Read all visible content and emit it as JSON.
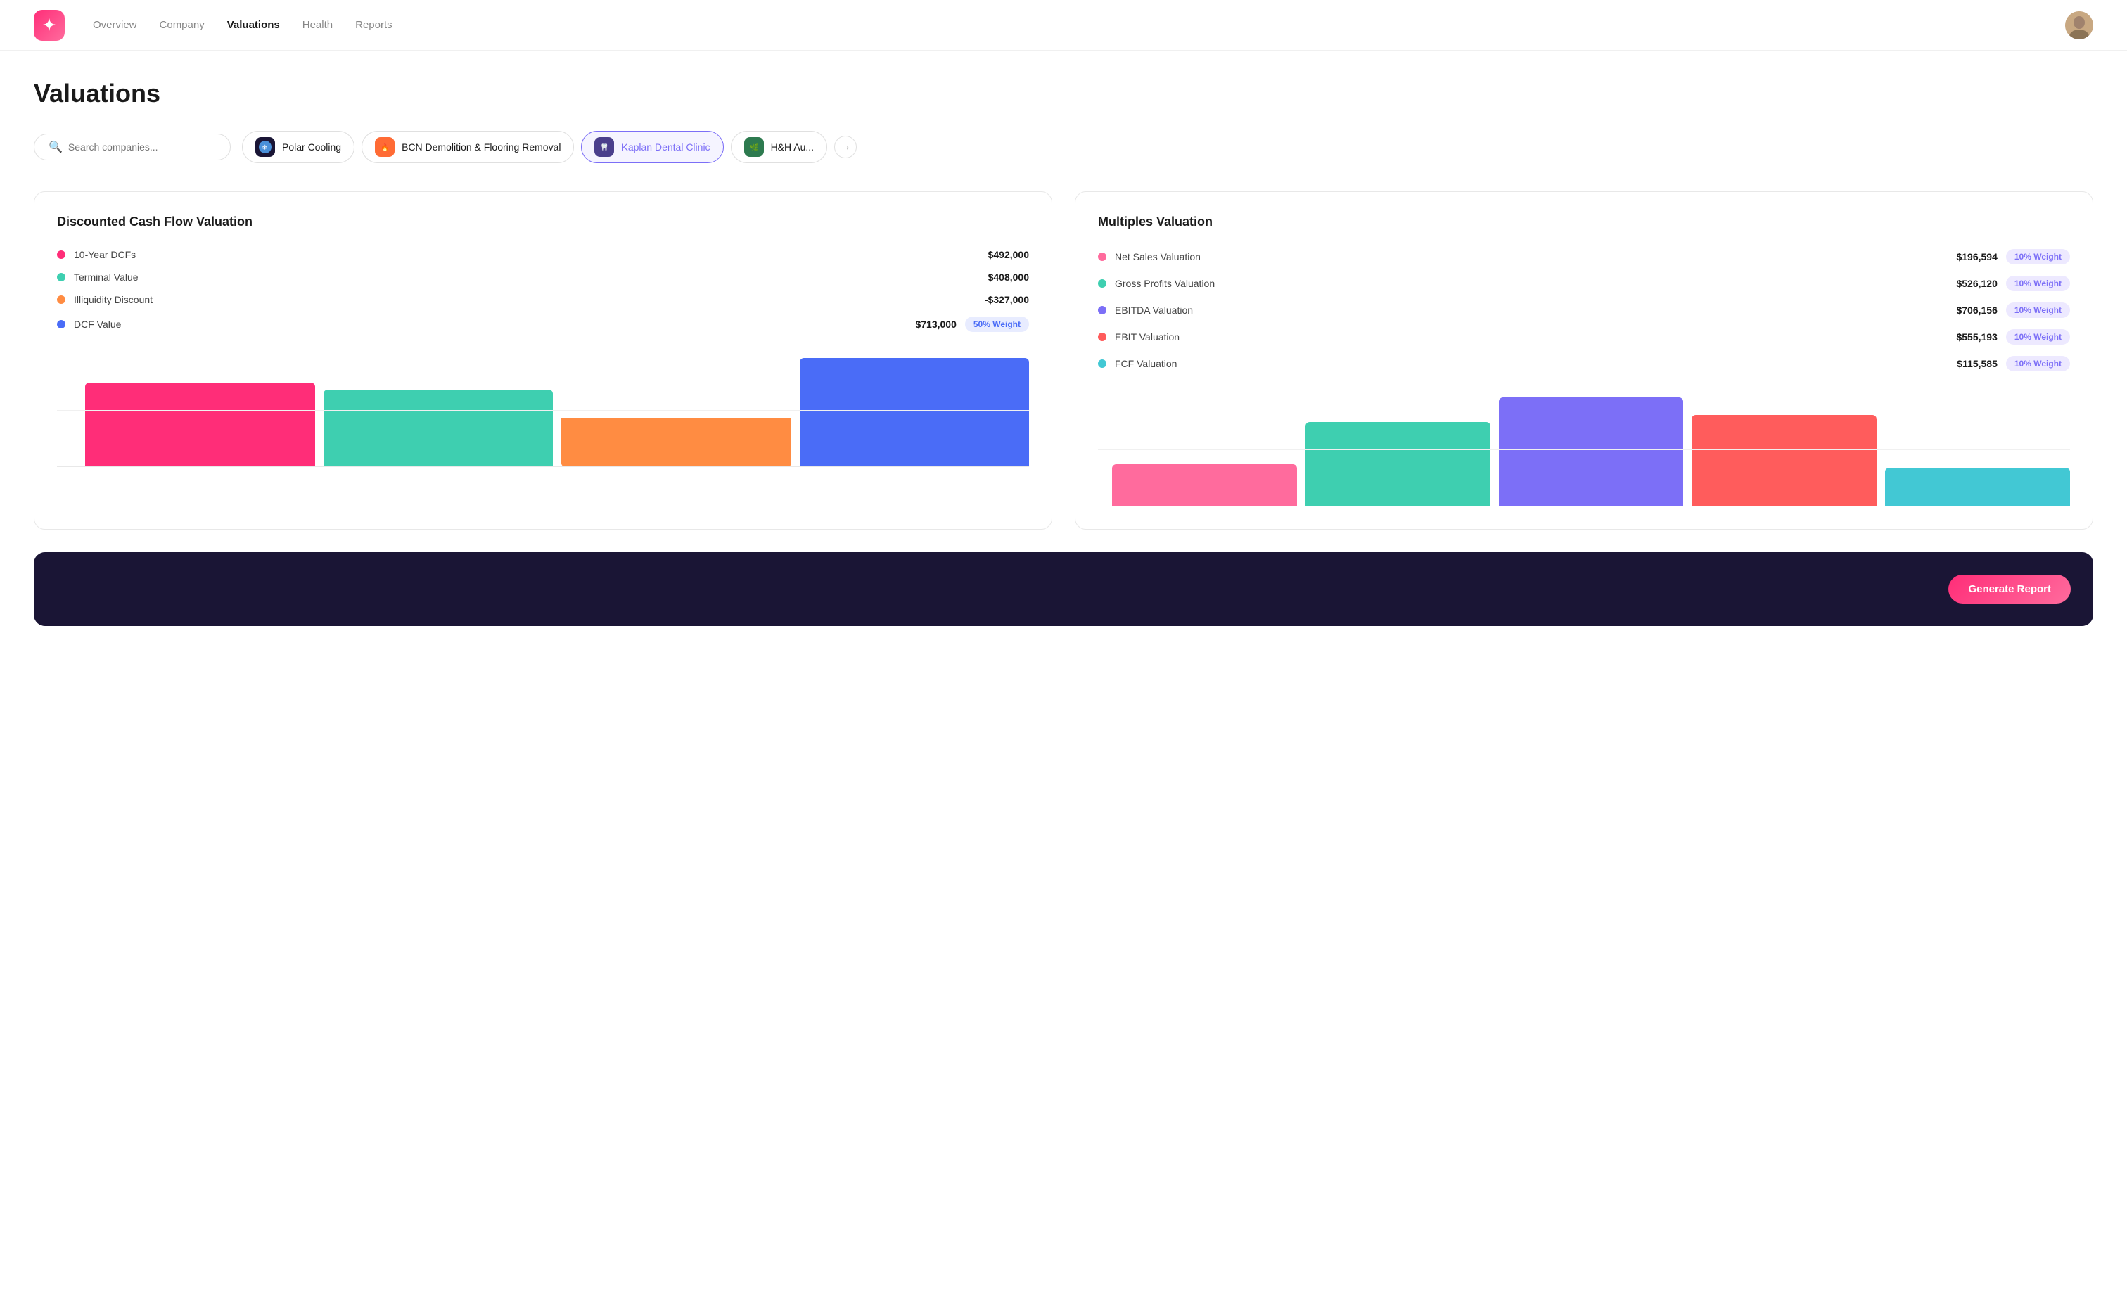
{
  "nav": {
    "links": [
      {
        "label": "Overview",
        "active": false
      },
      {
        "label": "Company",
        "active": false
      },
      {
        "label": "Valuations",
        "active": true
      },
      {
        "label": "Health",
        "active": false
      },
      {
        "label": "Reports",
        "active": false
      }
    ]
  },
  "page": {
    "title": "Valuations"
  },
  "search": {
    "placeholder": "Search companies..."
  },
  "companies": [
    {
      "name": "Polar Cooling",
      "icon": "❄️",
      "bg": "#1a1535",
      "active": false
    },
    {
      "name": "BCN Demolition & Flooring Removal",
      "icon": "🔥",
      "bg": "#ff6b35",
      "active": false
    },
    {
      "name": "Kaplan Dental Clinic",
      "icon": "🦷",
      "bg": "#4a3f8c",
      "active": true
    },
    {
      "name": "H&H Au...",
      "icon": "🌿",
      "bg": "#2d7a4f",
      "active": false
    }
  ],
  "dcf": {
    "title": "Discounted Cash Flow Valuation",
    "metrics": [
      {
        "label": "10-Year DCFs",
        "value": "$492,000",
        "color": "#ff2d78",
        "badge": null
      },
      {
        "label": "Terminal Value",
        "value": "$408,000",
        "color": "#3ecfb0",
        "badge": null
      },
      {
        "label": "Illiquidity Discount",
        "value": "-$327,000",
        "color": "#ff8c42",
        "badge": null
      },
      {
        "label": "DCF Value",
        "value": "$713,000",
        "color": "#4a6cf7",
        "badge": "50% Weight"
      }
    ],
    "bars": [
      {
        "color": "#ff2d78",
        "height": 120
      },
      {
        "color": "#3ecfb0",
        "height": 110
      },
      {
        "color": "#ff8c42",
        "height": 70,
        "negative": true
      },
      {
        "color": "#4a6cf7",
        "height": 155
      }
    ]
  },
  "multiples": {
    "title": "Multiples Valuation",
    "metrics": [
      {
        "label": "Net Sales Valuation",
        "value": "$196,594",
        "color": "#ff6b9d",
        "badge": "10% Weight"
      },
      {
        "label": "Gross Profits Valuation",
        "value": "$526,120",
        "color": "#3ecfb0",
        "badge": "10% Weight"
      },
      {
        "label": "EBITDA Valuation",
        "value": "$706,156",
        "color": "#7c6ff7",
        "badge": "10% Weight"
      },
      {
        "label": "EBIT Valuation",
        "value": "$555,193",
        "color": "#ff5c5c",
        "badge": "10% Weight"
      },
      {
        "label": "FCF Valuation",
        "value": "$115,585",
        "color": "#42c8d4",
        "badge": "10% Weight"
      }
    ],
    "bars": [
      {
        "color": "#ff6b9d",
        "height": 60
      },
      {
        "color": "#3ecfb0",
        "height": 120
      },
      {
        "color": "#7c6ff7",
        "height": 155
      },
      {
        "color": "#ff5c5c",
        "height": 130
      },
      {
        "color": "#42c8d4",
        "height": 55
      }
    ]
  },
  "bottom": {
    "btn_label": "Generate Report"
  }
}
